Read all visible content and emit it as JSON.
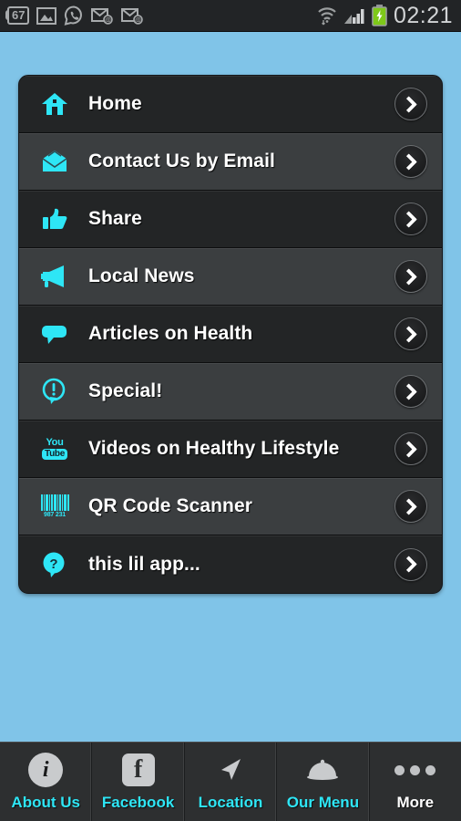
{
  "statusbar": {
    "notification_count": "67",
    "icons": [
      "message-count-badge",
      "gallery-image-icon",
      "whatsapp-icon",
      "email-at-icon",
      "email-at-icon"
    ],
    "right_icons": [
      "wifi-data-icon",
      "cellular-signal-icon",
      "battery-charging-icon"
    ],
    "clock": "02:21"
  },
  "menu": {
    "items": [
      {
        "label": "Home",
        "icon": "home-icon"
      },
      {
        "label": "Contact Us by Email",
        "icon": "open-envelope-icon"
      },
      {
        "label": "Share",
        "icon": "thumbs-up-icon"
      },
      {
        "label": "Local News",
        "icon": "megaphone-icon"
      },
      {
        "label": "Articles on Health",
        "icon": "speech-bubble-icon"
      },
      {
        "label": "Special!",
        "icon": "exclamation-bubble-icon"
      },
      {
        "label": "Videos on Healthy Lifestyle",
        "icon": "youtube-icon"
      },
      {
        "label": "QR Code Scanner",
        "icon": "barcode-icon"
      },
      {
        "label": "this lil app...",
        "icon": "question-bubble-icon"
      }
    ],
    "chevron_icon": "chevron-right-icon",
    "youtube_icon_text": {
      "top": "You",
      "bottom": "Tube"
    },
    "barcode_digits": "987 231"
  },
  "tabbar": {
    "tabs": [
      {
        "label": "About Us",
        "icon": "info-circle-icon",
        "highlight": false
      },
      {
        "label": "Facebook",
        "icon": "facebook-icon",
        "highlight": false
      },
      {
        "label": "Location",
        "icon": "navigation-arrow-icon",
        "highlight": false
      },
      {
        "label": "Our Menu",
        "icon": "food-cloche-icon",
        "highlight": false
      },
      {
        "label": "More",
        "icon": "more-dots-icon",
        "highlight": true
      }
    ]
  },
  "colors": {
    "background": "#80c4e8",
    "accent_cyan": "#2ee6f6",
    "row_dark": "#232526",
    "row_light": "#3b3e40",
    "statusbar": "#222426",
    "tabbar": "#2d2f30"
  }
}
